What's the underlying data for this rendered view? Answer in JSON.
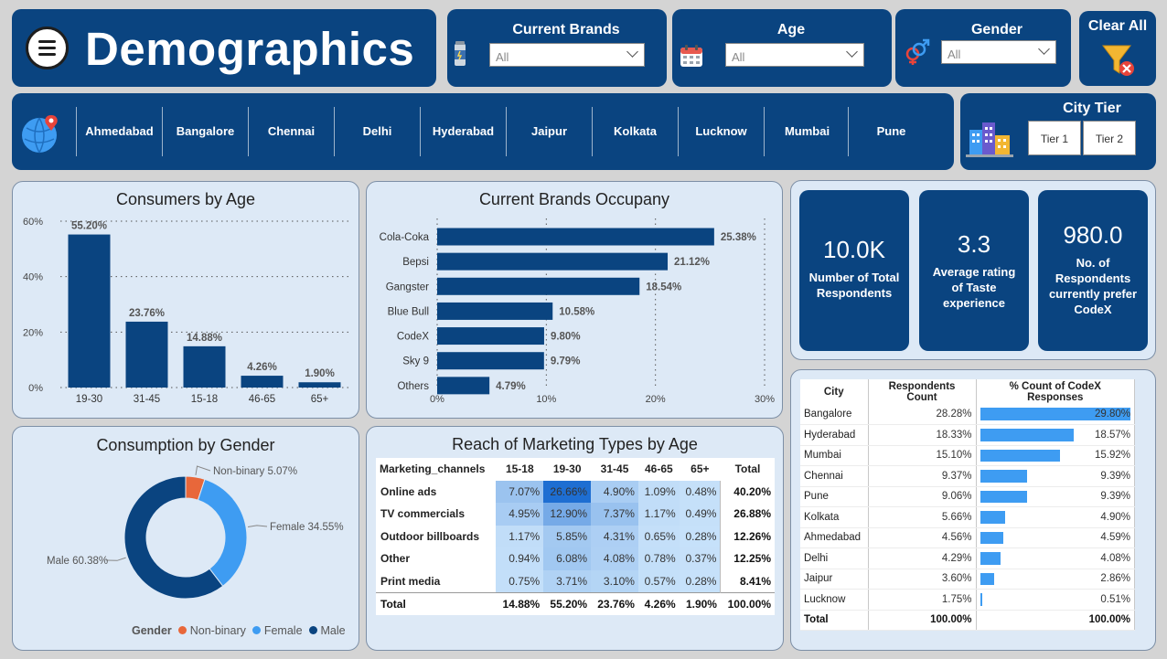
{
  "header": {
    "title": "Demographics",
    "filters": [
      {
        "label": "Current Brands",
        "value": "All",
        "icon": "energy-drink-can-icon"
      },
      {
        "label": "Age",
        "value": "All",
        "icon": "calendar-icon"
      },
      {
        "label": "Gender",
        "value": "All",
        "icon": "gender-icon"
      }
    ],
    "clear_all_label": "Clear All"
  },
  "city_slicer": {
    "cities": [
      "Ahmedabad",
      "Bangalore",
      "Chennai",
      "Delhi",
      "Hyderabad",
      "Jaipur",
      "Kolkata",
      "Lucknow",
      "Mumbai",
      "Pune"
    ]
  },
  "city_tier": {
    "label": "City Tier",
    "options": [
      "Tier 1",
      "Tier 2"
    ]
  },
  "kpis": [
    {
      "value": "10.0K",
      "label": "Number of Total Respondents"
    },
    {
      "value": "3.3",
      "label": "Average rating of Taste experience"
    },
    {
      "value": "980.0",
      "label": "No. of Respondents currently prefer CodeX"
    }
  ],
  "chart_data": [
    {
      "type": "bar",
      "title": "Consumers by Age",
      "categories": [
        "19-30",
        "31-45",
        "15-18",
        "46-65",
        "65+"
      ],
      "values": [
        55.2,
        23.76,
        14.88,
        4.26,
        1.9
      ],
      "data_labels": [
        "55.20%",
        "23.76%",
        "14.88%",
        "4.26%",
        "1.90%"
      ],
      "ylim": [
        0,
        60
      ],
      "yticks": [
        "0%",
        "20%",
        "40%",
        "60%"
      ],
      "grid": true,
      "color": "#0a4480"
    },
    {
      "type": "bar",
      "orientation": "horizontal",
      "title": "Current Brands Occupany",
      "categories": [
        "Cola-Coka",
        "Bepsi",
        "Gangster",
        "Blue Bull",
        "CodeX",
        "Sky 9",
        "Others"
      ],
      "values": [
        25.38,
        21.12,
        18.54,
        10.58,
        9.8,
        9.79,
        4.79
      ],
      "data_labels": [
        "25.38%",
        "21.12%",
        "18.54%",
        "10.58%",
        "9.80%",
        "9.79%",
        "4.79%"
      ],
      "xlim": [
        0,
        30
      ],
      "xticks": [
        "0%",
        "10%",
        "20%",
        "30%"
      ],
      "grid": true,
      "color": "#0a4480"
    },
    {
      "type": "pie",
      "donut": true,
      "title": "Consumption by Gender",
      "legend_title": "Gender",
      "legend_position": "bottom-right",
      "slices": [
        {
          "name": "Non-binary",
          "value": 5.07,
          "label": "Non-binary 5.07%",
          "color": "#e8673a"
        },
        {
          "name": "Female",
          "value": 34.55,
          "label": "Female 34.55%",
          "color": "#3e9cf2"
        },
        {
          "name": "Male",
          "value": 60.38,
          "label": "Male 60.38%",
          "color": "#0a4480"
        }
      ]
    },
    {
      "type": "table",
      "title": "Reach of Marketing Types by Age",
      "columns": [
        "Marketing_channels",
        "15-18",
        "19-30",
        "31-45",
        "46-65",
        "65+",
        "Total"
      ],
      "rows": [
        {
          "label": "Online ads",
          "values": [
            "7.07%",
            "26.66%",
            "4.90%",
            "1.09%",
            "0.48%"
          ],
          "total": "40.20%",
          "raw": [
            7.07,
            26.66,
            4.9,
            1.09,
            0.48
          ]
        },
        {
          "label": "TV commercials",
          "values": [
            "4.95%",
            "12.90%",
            "7.37%",
            "1.17%",
            "0.49%"
          ],
          "total": "26.88%",
          "raw": [
            4.95,
            12.9,
            7.37,
            1.17,
            0.49
          ]
        },
        {
          "label": "Outdoor billboards",
          "values": [
            "1.17%",
            "5.85%",
            "4.31%",
            "0.65%",
            "0.28%"
          ],
          "total": "12.26%",
          "raw": [
            1.17,
            5.85,
            4.31,
            0.65,
            0.28
          ]
        },
        {
          "label": "Other",
          "values": [
            "0.94%",
            "6.08%",
            "4.08%",
            "0.78%",
            "0.37%"
          ],
          "total": "12.25%",
          "raw": [
            0.94,
            6.08,
            4.08,
            0.78,
            0.37
          ]
        },
        {
          "label": "Print media",
          "values": [
            "0.75%",
            "3.71%",
            "3.10%",
            "0.57%",
            "0.28%"
          ],
          "total": "8.41%",
          "raw": [
            0.75,
            3.71,
            3.1,
            0.57,
            0.28
          ]
        }
      ],
      "total_row": {
        "label": "Total",
        "values": [
          "14.88%",
          "55.20%",
          "23.76%",
          "4.26%",
          "1.90%"
        ],
        "total": "100.00%"
      }
    },
    {
      "type": "table",
      "columns": [
        "City",
        "Respondents Count",
        "% Count of CodeX Responses"
      ],
      "rows": [
        {
          "city": "Bangalore",
          "count": "28.28%",
          "codex": "29.80%",
          "codex_value": 29.8
        },
        {
          "city": "Hyderabad",
          "count": "18.33%",
          "codex": "18.57%",
          "codex_value": 18.57
        },
        {
          "city": "Mumbai",
          "count": "15.10%",
          "codex": "15.92%",
          "codex_value": 15.92
        },
        {
          "city": "Chennai",
          "count": "9.37%",
          "codex": "9.39%",
          "codex_value": 9.39
        },
        {
          "city": "Pune",
          "count": "9.06%",
          "codex": "9.39%",
          "codex_value": 9.39
        },
        {
          "city": "Kolkata",
          "count": "5.66%",
          "codex": "4.90%",
          "codex_value": 4.9
        },
        {
          "city": "Ahmedabad",
          "count": "4.56%",
          "codex": "4.59%",
          "codex_value": 4.59
        },
        {
          "city": "Delhi",
          "count": "4.29%",
          "codex": "4.08%",
          "codex_value": 4.08
        },
        {
          "city": "Jaipur",
          "count": "3.60%",
          "codex": "2.86%",
          "codex_value": 2.86
        },
        {
          "city": "Lucknow",
          "count": "1.75%",
          "codex": "0.51%",
          "codex_value": 0.51
        }
      ],
      "total_row": {
        "city": "Total",
        "count": "100.00%",
        "codex": "100.00%"
      }
    }
  ]
}
